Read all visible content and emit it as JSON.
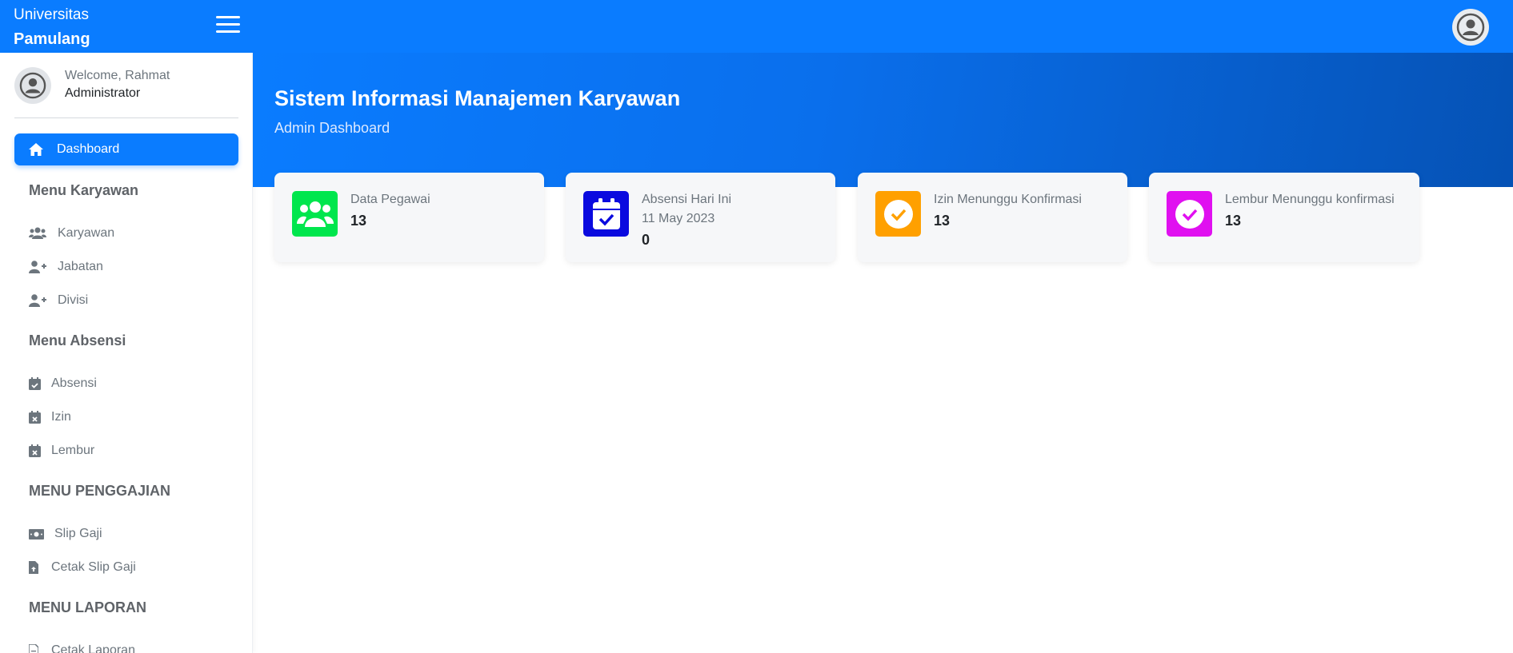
{
  "brand": {
    "line1": "Universitas",
    "line2": "Pamulang"
  },
  "sidebar": {
    "welcome": "Welcome, Rahmat",
    "role": "Administrator",
    "active_item": {
      "label": "Dashboard",
      "icon": "home-icon"
    },
    "sections": [
      {
        "title": "Menu Karyawan",
        "items": [
          {
            "label": "Karyawan",
            "icon": "users-icon"
          },
          {
            "label": "Jabatan",
            "icon": "user-plus-icon"
          },
          {
            "label": "Divisi",
            "icon": "user-plus-icon"
          }
        ]
      },
      {
        "title": "Menu Absensi",
        "items": [
          {
            "label": "Absensi",
            "icon": "calendar-check-icon"
          },
          {
            "label": "Izin",
            "icon": "calendar-x-icon"
          },
          {
            "label": "Lembur",
            "icon": "calendar-x-icon"
          }
        ]
      },
      {
        "title": "MENU PENGGAJIAN",
        "items": [
          {
            "label": "Slip Gaji",
            "icon": "money-bill-icon"
          },
          {
            "label": "Cetak Slip Gaji",
            "icon": "file-upload-icon"
          }
        ]
      },
      {
        "title": "MENU LAPORAN",
        "items": [
          {
            "label": "Cetak Laporan",
            "icon": "file-icon"
          }
        ]
      }
    ]
  },
  "header": {
    "title": "Sistem Informasi Manajemen Karyawan",
    "subtitle": "Admin Dashboard"
  },
  "cards": [
    {
      "title": "Data Pegawai",
      "value": "13",
      "color": "#00e64d",
      "icon": "users-icon"
    },
    {
      "title": "Absensi Hari Ini",
      "date": "11 May 2023",
      "value": "0",
      "color": "#0a0adf",
      "icon": "calendar-check-icon"
    },
    {
      "title": "Izin Menunggu Konfirmasi",
      "value": "13",
      "color": "#ffa000",
      "icon": "check-circle-icon"
    },
    {
      "title": "Lembur Menunggu konfirmasi",
      "value": "13",
      "color": "#e010f0",
      "icon": "check-circle-icon"
    }
  ],
  "colors": {
    "primary": "#0a7cff",
    "hero_dark": "#0552b5"
  }
}
